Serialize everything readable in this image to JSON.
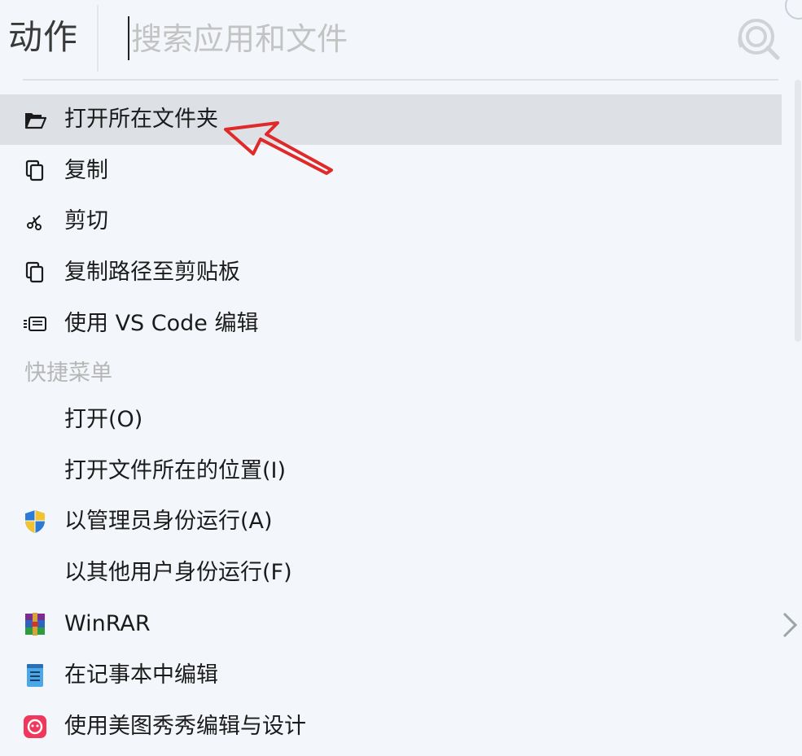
{
  "header": {
    "title": "动作",
    "search_placeholder": "搜索应用和文件",
    "search_value": ""
  },
  "items": [
    {
      "label": "打开所在文件夹",
      "icon": "folder-open-icon",
      "selected": true
    },
    {
      "label": "复制",
      "icon": "copy-icon"
    },
    {
      "label": "剪切",
      "icon": "scissors-icon"
    },
    {
      "label": "复制路径至剪贴板",
      "icon": "copy-icon"
    },
    {
      "label": "使用 VS Code 编辑",
      "icon": "vscode-icon"
    }
  ],
  "section": {
    "title": "快捷菜单"
  },
  "context_items": [
    {
      "label": "打开(O)",
      "icon": ""
    },
    {
      "label": "打开文件所在的位置(I)",
      "icon": ""
    },
    {
      "label": "以管理员身份运行(A)",
      "icon": "uac-shield-icon"
    },
    {
      "label": "以其他用户身份运行(F)",
      "icon": ""
    },
    {
      "label": "WinRAR",
      "icon": "winrar-icon",
      "has_submenu": true
    },
    {
      "label": "在记事本中编辑",
      "icon": "notepad-icon"
    },
    {
      "label": "使用美图秀秀编辑与设计",
      "icon": "meitu-icon"
    }
  ],
  "colors": {
    "background": "#f3f7fb",
    "selected_row": "#dde1e6",
    "annotation_arrow": "#e02a2a",
    "section_text": "#b6b6b6"
  }
}
